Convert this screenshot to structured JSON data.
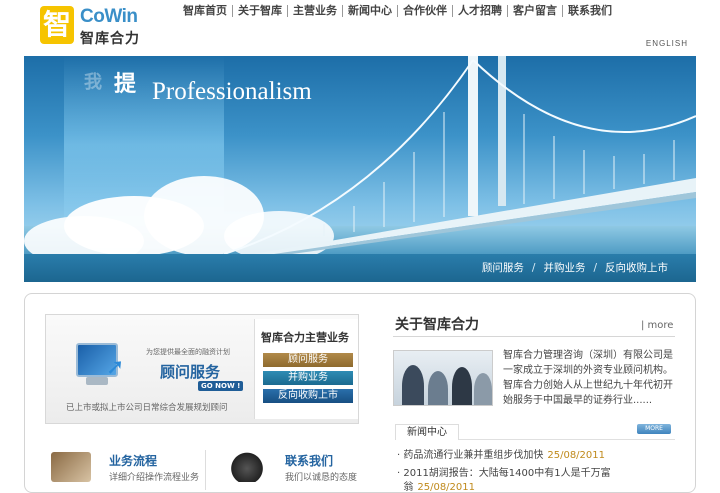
{
  "logo": {
    "mark": "智",
    "en": "CoWin",
    "cn": "智库合力"
  },
  "nav": [
    "智库首页",
    "关于智库",
    "主营业务",
    "新闻中心",
    "合作伙伴",
    "人才招聘",
    "客户留言",
    "联系我们"
  ],
  "lang": "ENGLISH",
  "banner": {
    "cn_main": "提",
    "cn_faint": "我",
    "en": "Professionalism",
    "links": [
      "顾问服务",
      "并购业务",
      "反向收购上市"
    ],
    "separator": "/",
    "colors": {
      "sky_top": "#1d6ea8",
      "bar": "#1c6690"
    }
  },
  "service_box": {
    "tag": "为您提供最全面的融资计划",
    "title": "顾问服务",
    "go": "GO NOW !",
    "desc": "已上市或拟上市公司日常综合发展规划顾问",
    "right_title": "智库合力主营业务",
    "links": [
      "顾问服务",
      "并购业务",
      "反向收购上市"
    ]
  },
  "mini": [
    {
      "title": "业务流程",
      "text": "详细介绍操作流程业务",
      "icon": "handshake-icon"
    },
    {
      "title": "联系我们",
      "text": "我们以诚恳的态度",
      "icon": "telephone-icon"
    }
  ],
  "about": {
    "title": "关于智库合力",
    "more": "| more",
    "text": "智库合力管理咨询（深圳）有限公司是一家成立于深圳的外资专业顾问机构。智库合力创始人从上世纪九十年代初开始服务于中国最早的证券行业......"
  },
  "news": {
    "tab": "新闻中心",
    "more": "MORE",
    "items": [
      {
        "title": "药品流通行业兼并重组步伐加快",
        "date": "25/08/2011"
      },
      {
        "title": "2011胡润报告：大陆每1400中有1人是千万富",
        "date": ""
      },
      {
        "title": "翁",
        "date": "25/08/2011"
      }
    ]
  }
}
